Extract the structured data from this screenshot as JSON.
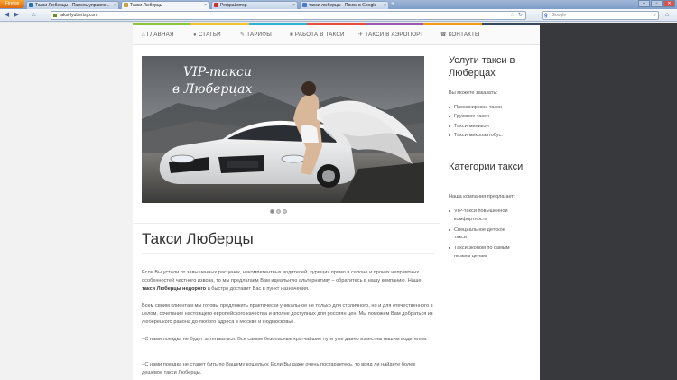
{
  "browser": {
    "firefox_label": "Firefox",
    "tabs": [
      {
        "label": "Такси Люберцы - Панель управле...",
        "favicon_color": "#2a6db0"
      },
      {
        "label": "Такси Люберцы",
        "favicon_color": "#c8a040",
        "active": true
      },
      {
        "label": "Рефраймтор",
        "favicon_color": "#d03030"
      },
      {
        "label": "такси люберцы - Поиск в Google",
        "favicon_color": "#4a7ad0"
      }
    ],
    "tab_close": "×",
    "new_tab": "+",
    "window_controls": [
      "–",
      "▫",
      "✕"
    ],
    "url": "taksi-lyubertsy.com",
    "search_placeholder": "Google",
    "search_engine_glyph": "g",
    "back_glyph": "◀",
    "forward_glyph": "▶",
    "home_glyph": "⌂",
    "star_glyph": "☆",
    "reload_glyph": "↻",
    "search_glyph": "⌕"
  },
  "menu": {
    "items": [
      {
        "label": "ГЛАВНАЯ",
        "icon": "home-icon",
        "glyph": "⌂"
      },
      {
        "label": "СТАТЬИ",
        "icon": "info-icon",
        "glyph": "●"
      },
      {
        "label": "ТАРИФЫ",
        "icon": "pencil-icon",
        "glyph": "✎"
      },
      {
        "label": "РАБОТА В ТАКСИ",
        "icon": "briefcase-icon",
        "glyph": "■"
      },
      {
        "label": "ТАКСИ В АЭРОПОРТ",
        "icon": "plane-icon",
        "glyph": "✈"
      },
      {
        "label": "КОНТАКТЫ",
        "icon": "phone-icon",
        "glyph": "☎"
      }
    ],
    "strip_colors": [
      "#8cc63f",
      "#f2c230",
      "#31b0d5",
      "#e74c3c",
      "#9b59b6",
      "#f39c12",
      "#34495e"
    ]
  },
  "slider": {
    "line1": "VIP-такси",
    "line2": "в Люберцах",
    "dots": 3,
    "active_dot": 0
  },
  "main": {
    "title": "Такси Люберцы",
    "paragraphs": [
      {
        "before": "Если Вы устали от завышенных расценок, некомпетентных водителей, курящих прямо в салоне и прочих неприятных особенностей частного извоза, то мы предлагаем Вам идеальную альтернативу – обратитесь в нашу компанию. Наше ",
        "bold": "такси Люберцы недорого",
        "after": " и быстро доставит Вас в пункт назначения."
      },
      {
        "before": "Всем своим клиентам мы готовы предложить практически уникальное не только для столичного, но и для отечественного в целом, сочетание настоящего европейского качества и вполне доступных для россиян цен. Мы поможем Вам добраться из люберецкого района до любого адреса в Москве и Подмосковье.",
        "bold": "",
        "after": ""
      },
      {
        "before": "- С нами поездка не будет затягиваться. Все самые безопасные кратчайшие пути уже давно известны нашим водителям.",
        "bold": "",
        "after": ""
      },
      {
        "before": "- С нами поездка не станет бить по Вашему кошельку. Если Вы даже очень постараетесь, то вряд ли найдете более дешевое такси Люберцы.",
        "bold": "",
        "after": ""
      }
    ]
  },
  "sidebar": {
    "services_title": "Услуги такси в Люберцах",
    "services_sub": "Вы можете заказать:",
    "services": [
      "Пассажирское такси",
      "Грузовое такси",
      "Такси-минивэн",
      "Такси-микроавтобус."
    ],
    "categories_title": "Категории такси",
    "categories_sub": "Наша компания предлагает:",
    "categories": [
      [
        "VIP-такси повышенной",
        "комфортности"
      ],
      [
        "Специальное детское",
        "такси"
      ],
      [
        "Такси эконом по самым",
        "низким ценам."
      ]
    ]
  }
}
